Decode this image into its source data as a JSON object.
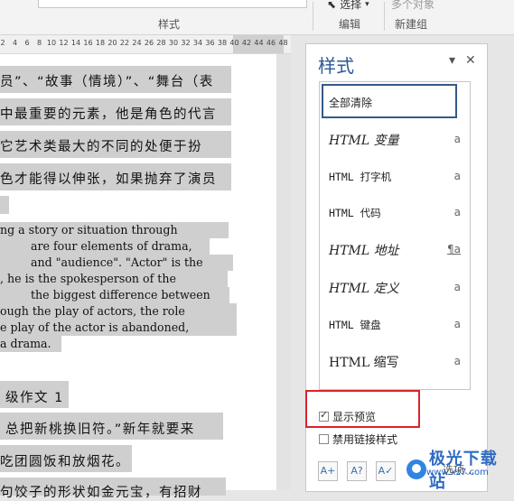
{
  "ribbon": {
    "styles_group_label": "样式",
    "select_label": "选择",
    "edit_group_label": "编辑",
    "multi_objects_label": "多个对象",
    "new_group_label": "新建组"
  },
  "ruler": {
    "ticks": [
      "2",
      "4",
      "6",
      "8",
      "10",
      "12",
      "14",
      "16",
      "18",
      "20",
      "22",
      "24",
      "26",
      "28",
      "30",
      "32",
      "34",
      "36",
      "38",
      "40",
      "42",
      "44",
      "46",
      "48"
    ]
  },
  "document": {
    "zh_lines": [
      "员”、“故事（情境）”、“舞台（表",
      "中最重要的元素，他是角色的代言",
      "它艺术类最大的不同的处便于扮",
      "色才能得以伸张，如果抛弃了演员"
    ],
    "en_lines": [
      "ng a story or situation through",
      "are four elements of drama,",
      "and \"audience\". \"Actor\" is the",
      ", he is the spokesperson of the",
      "the biggest difference between",
      "ough the play of actors, the role",
      "e play of the actor is abandoned,",
      "a drama."
    ],
    "zh_lines_2": [
      "级作文 1",
      "总把新桃换旧符。”新年就要来",
      "吃团圆饭和放烟花。",
      "句饺子的形状如金元宝，有招财"
    ]
  },
  "styles_pane": {
    "title": "样式",
    "dropdown_glyph": "▾",
    "close_glyph": "✕",
    "items": [
      {
        "label": "全部清除",
        "mark": ""
      },
      {
        "label": "HTML 变量",
        "mark": "a"
      },
      {
        "label": "HTML 打字机",
        "mark": "a"
      },
      {
        "label": "HTML 代码",
        "mark": "a"
      },
      {
        "label": "HTML 地址",
        "mark": "¶a"
      },
      {
        "label": "HTML 定义",
        "mark": "a"
      },
      {
        "label": "HTML 键盘",
        "mark": "a"
      },
      {
        "label": "HTML 缩写",
        "mark": "a"
      }
    ],
    "show_preview_label": "显示预览",
    "show_preview_checked": true,
    "disable_linked_label": "禁用链接样式",
    "disable_linked_checked": false,
    "options_label": "选项...",
    "accent_color": "#2b5797",
    "highlight_color": "#d9232a"
  },
  "watermark": {
    "text": "极光下载站",
    "sub": "www.xz7.com"
  }
}
